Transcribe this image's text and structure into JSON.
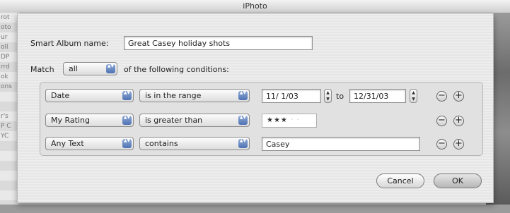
{
  "window": {
    "title": "iPhoto"
  },
  "background": {
    "sidebar_fragments": [
      "rot",
      "oto",
      "ur",
      "oll",
      "DP",
      "rrd",
      "ok",
      "ons",
      "",
      "",
      "r's",
      "P C",
      "YC"
    ]
  },
  "form": {
    "name_label": "Smart Album name:",
    "name_value": "Great Casey holiday shots",
    "match_label": "Match",
    "match_value": "all",
    "match_suffix": "of the following conditions:"
  },
  "conditions": [
    {
      "field": "Date",
      "operator": "is in the range",
      "from": "11/ 1/03",
      "to_label": "to",
      "to": "12/31/03"
    },
    {
      "field": "My Rating",
      "operator": "is greater than",
      "rating": {
        "filled": "★★★",
        "empty": "· ·"
      }
    },
    {
      "field": "Any Text",
      "operator": "contains",
      "value": "Casey"
    }
  ],
  "controls": {
    "remove_symbol": "−",
    "add_symbol": "+",
    "popup_arrows": "▲▼"
  },
  "buttons": {
    "cancel": "Cancel",
    "ok": "OK"
  }
}
